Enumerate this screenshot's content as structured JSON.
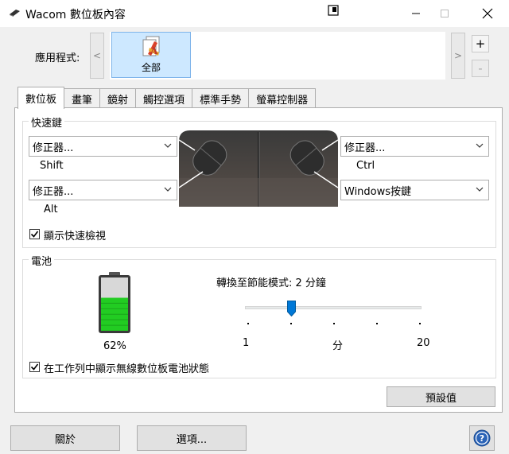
{
  "window": {
    "title": "Wacom 數位板內容",
    "minimize_icon": "minimize-icon",
    "maximize_icon": "maximize-icon",
    "close_icon": "close-icon"
  },
  "app_selector": {
    "label": "應用程式:",
    "prev": "<",
    "next": ">",
    "add": "+",
    "remove": "-",
    "items": [
      {
        "label": "全部",
        "selected": true
      }
    ]
  },
  "tabs": [
    {
      "label": "數位板",
      "active": true
    },
    {
      "label": "畫筆",
      "active": false
    },
    {
      "label": "鏡射",
      "active": false
    },
    {
      "label": "觸控選項",
      "active": false
    },
    {
      "label": "標準手勢",
      "active": false
    },
    {
      "label": "螢幕控制器",
      "active": false
    }
  ],
  "express_keys": {
    "group_label": "快速鍵",
    "left_top": {
      "value": "修正器...",
      "key": "Shift"
    },
    "left_bottom": {
      "value": "修正器...",
      "key": "Alt"
    },
    "right_top": {
      "value": "修正器...",
      "key": "Ctrl"
    },
    "right_bottom": {
      "value": "Windows按鍵"
    },
    "show_express_view": {
      "label": "顯示快速檢視",
      "checked": true
    }
  },
  "battery": {
    "group_label": "電池",
    "level_text": "62%",
    "level": 0.62,
    "power_save_label": "轉換至節能模式: 2 分鐘",
    "slider": {
      "min_label": "1",
      "unit_label": "分",
      "max_label": "20",
      "min": 1,
      "max": 20,
      "value": 2
    },
    "show_in_taskbar": {
      "label": "在工作列中顯示無線數位板電池狀態",
      "checked": true
    },
    "color": "#22cc22"
  },
  "defaults_button": "預設值",
  "footer": {
    "about": "關於",
    "options": "選項...",
    "help_icon": "help-icon"
  }
}
